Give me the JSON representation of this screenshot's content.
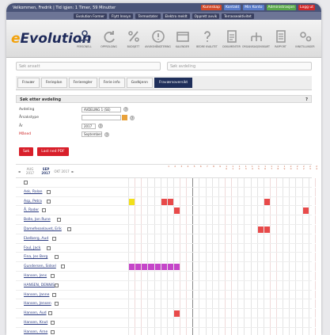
{
  "topbar": {
    "welcome": "Velkommen, Fredrik | Tid igjen: 1 Timer, 59 Minutter",
    "links": [
      {
        "label": "Kunnskap",
        "color": "#d24a2a"
      },
      {
        "label": "Kontakt",
        "color": "#5a7cc9"
      },
      {
        "label": "Min Konto",
        "color": "#5a7cc9"
      },
      {
        "label": "Administrasjon",
        "color": "#5aa84a"
      },
      {
        "label": "Logg ut",
        "color": "#d22a2a"
      }
    ]
  },
  "subnav": [
    "Evolution Former",
    "Flytt Innsyn",
    "Termostater",
    "Elektro meldt",
    "Opprett avvik",
    "Terrasseaktivitet"
  ],
  "logo": {
    "prefix": "e",
    "word": "Evolution"
  },
  "modules": [
    {
      "icon": "people-icon",
      "label": "PERSONELL"
    },
    {
      "icon": "refresh-icon",
      "label": "OPPFØLGING"
    },
    {
      "icon": "percent-icon",
      "label": "BUDSJETT"
    },
    {
      "icon": "warning-icon",
      "label": "AVVIKSHÅNDTERING"
    },
    {
      "icon": "calendar-icon",
      "label": "KALENDER"
    },
    {
      "icon": "help-icon",
      "label": "BEDRE KVALITET"
    },
    {
      "icon": "document-icon",
      "label": "DOKUMENTER"
    },
    {
      "icon": "org-icon",
      "label": "ORGANISASJONSKART"
    },
    {
      "icon": "list-icon",
      "label": "RAPPORT"
    },
    {
      "icon": "settings-icon",
      "label": "INNSTILLINGER"
    }
  ],
  "search": {
    "employee_placeholder": "Søk ansatt",
    "department_placeholder": "Søk avdeling"
  },
  "tabs": [
    "Fravær",
    "Ferieplan",
    "Ferieregler",
    "Ferie info",
    "Godkjenn",
    "Fraværsoversikt"
  ],
  "active_tab": 5,
  "panel": {
    "title": "Søk etter avdeling",
    "help": "?"
  },
  "form": {
    "avdeling_label": "Avdeling",
    "avdeling_value": "AVDELING 1 (SE)",
    "arsakstype_label": "Årsakstype",
    "arsakstype_value": "",
    "ar_label": "År",
    "ar_value": "2017",
    "maned_label": "Måned",
    "maned_value": "September"
  },
  "buttons": {
    "search": "Søk",
    "export": "Last ned PDF"
  },
  "calendar": {
    "prev_month": "AUG 2017",
    "cur_month": "SEP 2017",
    "next_month": "OKT 2017",
    "prev_arrow": "◄",
    "next_arrow": "►",
    "days": 30,
    "weekend_days": [
      2,
      3,
      9,
      10,
      16,
      17,
      23,
      24,
      30
    ],
    "current_day": 11,
    "colors": {
      "red": "#e84a4a",
      "yellow": "#f2e01a",
      "magenta": "#c545c9"
    },
    "rows": [
      {
        "name": "",
        "marks": []
      },
      {
        "name": "Ask, Rolan",
        "marks": []
      },
      {
        "name": "Asp, Petra",
        "marks": [
          {
            "day": 1,
            "c": "yellow"
          },
          {
            "day": 6,
            "c": "red"
          },
          {
            "day": 7,
            "c": "red"
          },
          {
            "day": 22,
            "c": "red"
          }
        ]
      },
      {
        "name": "Å, Roder",
        "marks": [
          {
            "day": 8,
            "c": "red"
          },
          {
            "day": 28,
            "c": "red"
          }
        ]
      },
      {
        "name": "Bolle, Jon Rune",
        "marks": []
      },
      {
        "name": "Damefesselavet, Erik",
        "marks": [
          {
            "day": 21,
            "c": "red"
          },
          {
            "day": 22,
            "c": "red"
          }
        ]
      },
      {
        "name": "Ekelberg, Aud",
        "marks": []
      },
      {
        "name": "Foul, Jack",
        "marks": []
      },
      {
        "name": "Fina, Jes Berg",
        "marks": []
      },
      {
        "name": "Gundersen, Sidsel",
        "marks": [
          {
            "day": 1,
            "c": "magenta"
          },
          {
            "day": 2,
            "c": "magenta"
          },
          {
            "day": 3,
            "c": "magenta"
          },
          {
            "day": 4,
            "c": "magenta"
          },
          {
            "day": 5,
            "c": "magenta"
          },
          {
            "day": 6,
            "c": "magenta"
          },
          {
            "day": 7,
            "c": "magenta"
          },
          {
            "day": 8,
            "c": "magenta"
          }
        ]
      },
      {
        "name": "Hansen, Jens",
        "marks": []
      },
      {
        "name": "HANSEN, DENNIS",
        "marks": []
      },
      {
        "name": "Hansen, Janne",
        "marks": []
      },
      {
        "name": "Hansen, Jensen",
        "marks": []
      },
      {
        "name": "Hansen, Aud",
        "marks": [
          {
            "day": 8,
            "c": "red"
          }
        ]
      },
      {
        "name": "Hansen, Knut",
        "marks": []
      },
      {
        "name": "Hansen, Arne",
        "marks": []
      }
    ]
  }
}
